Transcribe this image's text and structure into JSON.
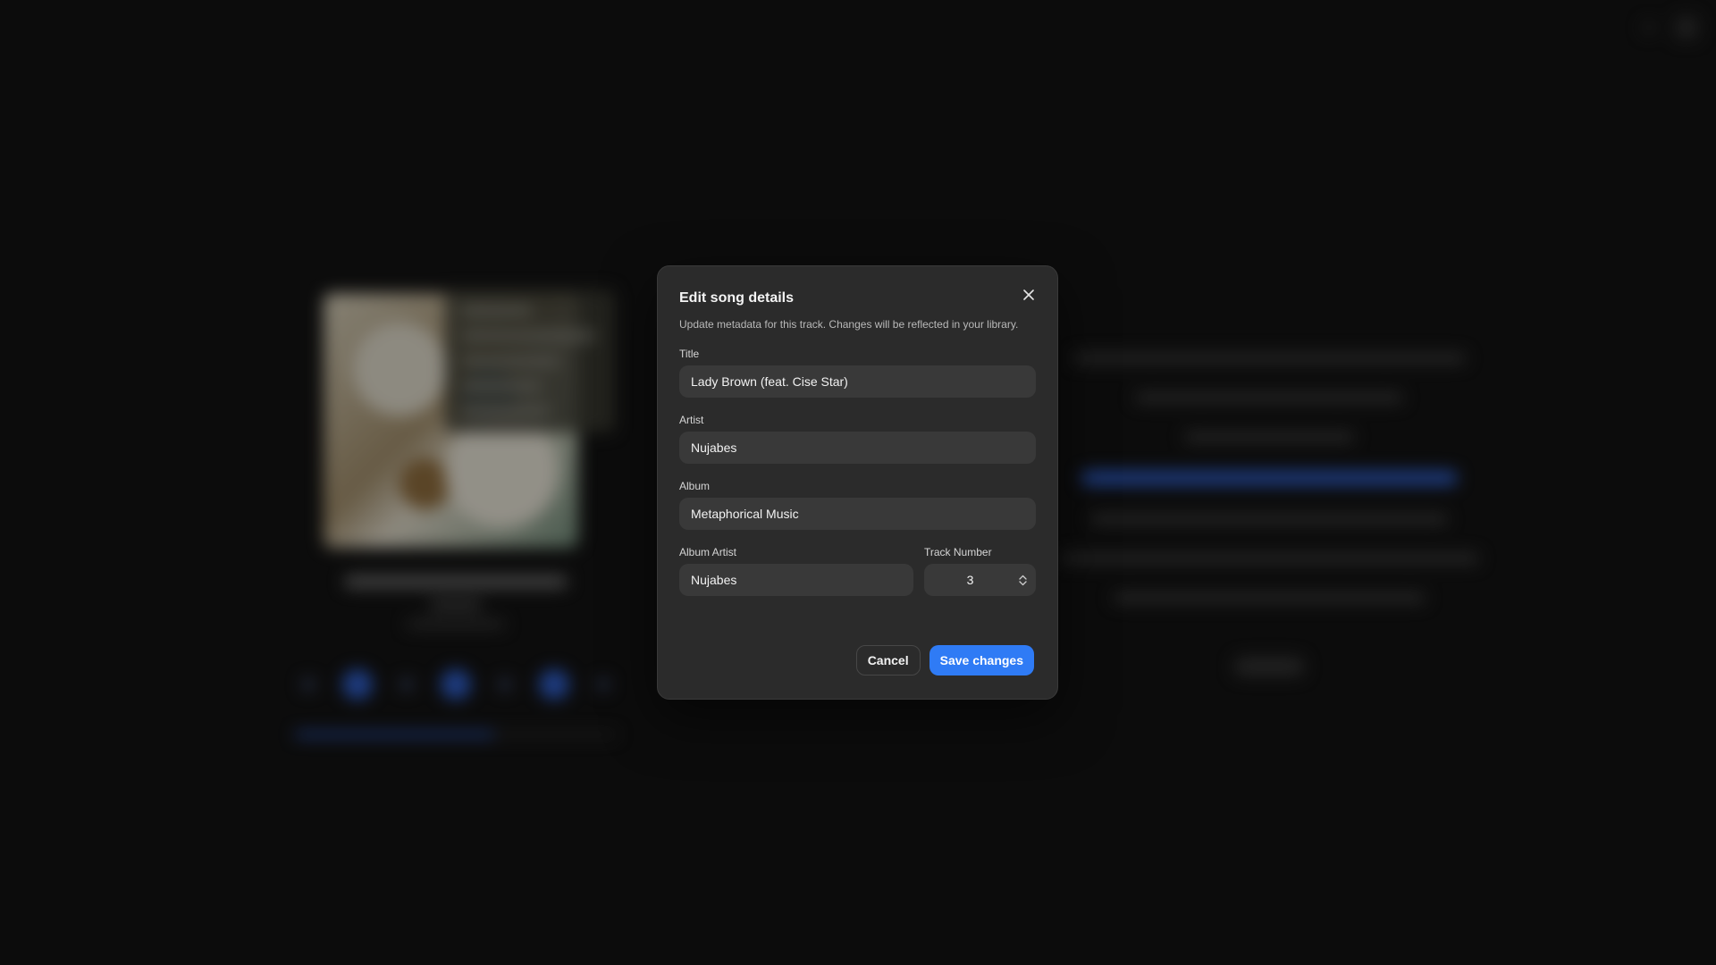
{
  "dialog": {
    "title": "Edit song details",
    "description": "Update metadata for this track. Changes will be reflected in your library.",
    "close_icon": "close-icon",
    "fields": {
      "title": {
        "label": "Title",
        "value": "Lady Brown (feat. Cise Star)"
      },
      "artist": {
        "label": "Artist",
        "value": "Nujabes"
      },
      "album": {
        "label": "Album",
        "value": "Metaphorical Music"
      },
      "album_artist": {
        "label": "Album Artist",
        "value": "Nujabes"
      },
      "track_number": {
        "label": "Track Number",
        "value": "3"
      }
    },
    "buttons": {
      "cancel": "Cancel",
      "save": "Save changes"
    }
  },
  "colors": {
    "accent": "#2f7bf5",
    "dialog_bg": "#2b2b2b",
    "input_bg": "#393939",
    "page_bg": "#131313"
  }
}
